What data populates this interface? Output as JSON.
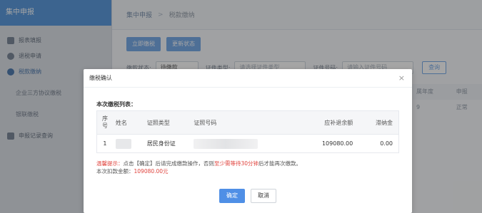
{
  "sidebar": {
    "title": "集中申报",
    "items": [
      {
        "label": "报表填报",
        "icon": "document-icon"
      },
      {
        "label": "退税申请",
        "icon": "refund-icon"
      },
      {
        "label": "税款缴纳",
        "icon": "person-tax-icon"
      },
      {
        "label": "企业三方协议缴税",
        "icon": ""
      },
      {
        "label": "银联缴税",
        "icon": ""
      },
      {
        "label": "申报记录查询",
        "icon": "search-record-icon"
      }
    ]
  },
  "breadcrumb": {
    "root": "集中申报",
    "separator": ">",
    "current": "税款缴纳"
  },
  "toolbar": {
    "pay_now": "立即缴税",
    "refresh_status": "更新状态"
  },
  "filters": {
    "status_label": "缴款状态:",
    "status_value": "待缴款",
    "id_type_label": "证件类型:",
    "id_type_placeholder": "请选择证件类型",
    "id_number_label": "证件号码:",
    "id_number_placeholder": "请输入证件号码",
    "query": "查询"
  },
  "background_table": {
    "headers": [
      "属年度",
      "申报"
    ],
    "row": [
      "9",
      "正常"
    ]
  },
  "modal": {
    "title": "缴税确认",
    "close": "×",
    "list_title": "本次缴税列表：",
    "columns": {
      "seq": "序号",
      "name": "姓名",
      "id_type": "证照类型",
      "id_number": "证照号码",
      "amount_due": "应补退余额",
      "late_fee": "滞纳金"
    },
    "rows": [
      {
        "seq": "1",
        "id_type": "居民身份证",
        "amount_due": "109080.00",
        "late_fee": "0.00"
      }
    ],
    "tip_label": "温馨提示：",
    "tip_text_1": "点击【确定】后请完成缴款操作，否则",
    "tip_highlight": "至少需等待30分钟",
    "tip_text_2": "后才能再次缴款。",
    "total_label": "本次扣款金额：",
    "total_value": "109080.00元",
    "ok": "确定",
    "cancel": "取消"
  }
}
